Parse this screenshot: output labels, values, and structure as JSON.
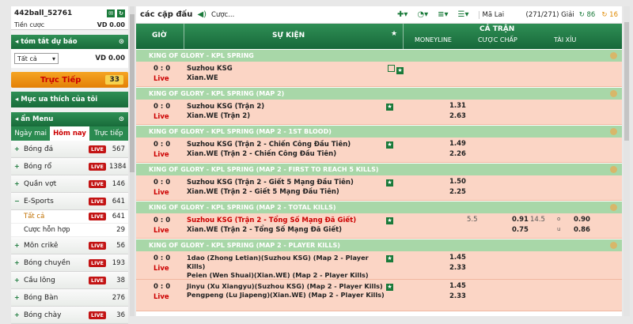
{
  "account": {
    "username": "442ball_52761",
    "balance_label": "Tiền cược",
    "balance_value": "VD 0.00"
  },
  "summary": {
    "title": "tóm tắt dự báo",
    "select_value": "Tất cả",
    "value": "VD 0.00"
  },
  "live": {
    "label": "Trực Tiếp",
    "count": "33"
  },
  "favorites": {
    "label": "Mục ưa thích của tôi"
  },
  "menu": {
    "title": "ẩn Menu",
    "tabs": [
      {
        "label": "Ngày mai"
      },
      {
        "label": "Hôm nay"
      },
      {
        "label": "Trực tiếp"
      }
    ]
  },
  "live_badge": "LIVE",
  "sports": [
    {
      "name": "Bóng đá",
      "count": "567"
    },
    {
      "name": "Bóng rổ",
      "count": "1384"
    },
    {
      "name": "Quần vợt",
      "count": "146"
    },
    {
      "name": "E-Sports",
      "count": "641"
    }
  ],
  "esports_sub": [
    {
      "name": "Tất cả",
      "count": "641"
    },
    {
      "name": "Cược hỗn hợp",
      "count": "29"
    }
  ],
  "sports2": [
    {
      "name": "Môn crikê",
      "count": "56"
    },
    {
      "name": "Bóng chuyền",
      "count": "193"
    },
    {
      "name": "Cầu lông",
      "count": "38"
    },
    {
      "name": "Bóng Bàn",
      "count": "276"
    },
    {
      "name": "Bóng chày",
      "count": "36"
    }
  ],
  "toolbar": {
    "title": "các cặp đấu",
    "search_placeholder": "Cược...",
    "lang": "Mã Lai",
    "count": "(271/271) Giải",
    "c1": "86",
    "c2": "16"
  },
  "table": {
    "col_time": "GIỜ",
    "col_event": "SỰ KIỆN",
    "col_group": "CẢ TRẬN",
    "col_ml": "MONEYLINE",
    "col_hc": "CƯỢC CHẤP",
    "col_ou": "TÀI XỈU"
  },
  "sections": [
    {
      "title": "KING OF GLORY - KPL SPRING",
      "time": "0 : 0",
      "status": "Live",
      "home": "Suzhou KSG",
      "away": "Xian.WE",
      "o1": "",
      "o2": ""
    },
    {
      "title": "KING OF GLORY - KPL SPRING (MAP 2)",
      "time": "0 : 0",
      "status": "Live",
      "home": "Suzhou KSG (Trận 2)",
      "away": "Xian.WE (Trận 2)",
      "o1": "1.31",
      "o2": "2.63"
    },
    {
      "title": "KING OF GLORY - KPL SPRING (MAP 2 - 1ST BLOOD)",
      "time": "0 : 0",
      "status": "Live",
      "home": "Suzhou KSG (Trận 2 - Chiến Công Đầu Tiên)",
      "away": "Xian.WE (Trận 2 - Chiến Công Đầu Tiên)",
      "o1": "1.49",
      "o2": "2.26"
    },
    {
      "title": "KING OF GLORY - KPL SPRING (MAP 2 - FIRST TO REACH 5 KILLS)",
      "time": "0 : 0",
      "status": "Live",
      "home": "Suzhou KSG (Trận 2 - Giết 5 Mạng Đầu Tiên)",
      "away": "Xian.WE (Trận 2 - Giết 5 Mạng Đầu Tiên)",
      "o1": "1.50",
      "o2": "2.25"
    },
    {
      "title": "KING OF GLORY - KPL SPRING (MAP 2 - TOTAL KILLS)",
      "time": "0 : 0",
      "status": "Live",
      "home": "Suzhou KSG (Trận 2 - Tổng Số Mạng Đã Giết)",
      "away": "Xian.WE (Trận 2 - Tổng Số Mạng Đã Giết)",
      "o1": "",
      "o2": "",
      "hc": "5.5",
      "hc1": "0.91",
      "hc2": "0.75",
      "ou": "14.5",
      "ou_o": "o",
      "ou_u": "u",
      "ou1": "0.90",
      "ou2": "0.86"
    },
    {
      "title": "KING OF GLORY - KPL SPRING (MAP 2 - PLAYER KILLS)",
      "rows": [
        {
          "time": "0 : 0",
          "status": "Live",
          "home": "1dao (Zhong Letian)(Suzhou KSG) (Map 2 - Player Kills)",
          "away": "Peien (Wen Shuai)(Xian.WE) (Map 2 - Player Kills)",
          "o1": "1.45",
          "o2": "2.33"
        },
        {
          "time": "0 : 0",
          "status": "Live",
          "home": "Jinyu (Xu Xiangyu)(Suzhou KSG) (Map 2 - Player Kills)",
          "away": "Pengpeng (Lu Jiapeng)(Xian.WE) (Map 2 - Player Kills)",
          "o1": "1.45",
          "o2": "2.33"
        }
      ]
    }
  ]
}
